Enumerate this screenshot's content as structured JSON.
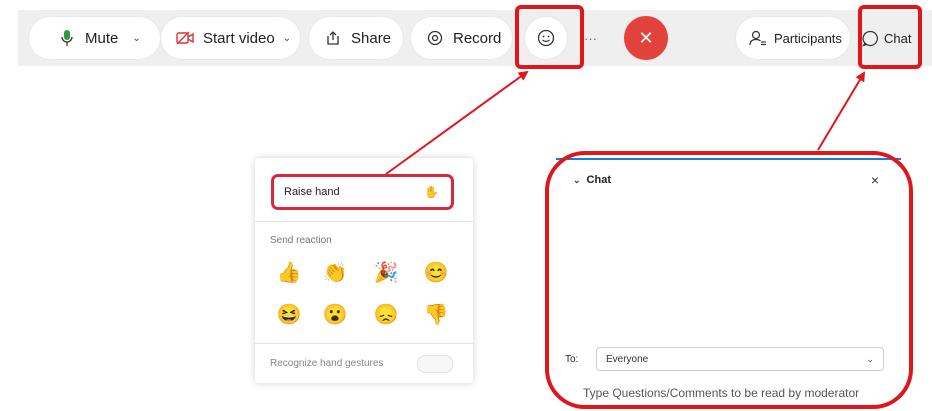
{
  "toolbar": {
    "mute_label": "Mute",
    "start_video_label": "Start video",
    "share_label": "Share",
    "record_label": "Record",
    "more_label": "···",
    "participants_label": "Participants",
    "chat_label": "Chat",
    "end_call_icon": "close-icon",
    "colors": {
      "bar": "#efefef",
      "end_call": "#e2423b",
      "mic": "#2e9b3a",
      "video_off": "#d9353a"
    }
  },
  "reactions": {
    "raise_hand_label": "Raise hand",
    "send_reaction_label": "Send reaction",
    "emojis": [
      "👍",
      "👏",
      "🎉",
      "😊",
      "😆",
      "😮",
      "😞",
      "👎"
    ],
    "gestures_label": "Recognize hand gestures"
  },
  "chat": {
    "title": "Chat",
    "close_glyph": "×",
    "to_label": "To:",
    "recipient": "Everyone",
    "input_placeholder": "Type Questions/Comments to be read by moderator"
  },
  "highlight_color": "#e0161c"
}
